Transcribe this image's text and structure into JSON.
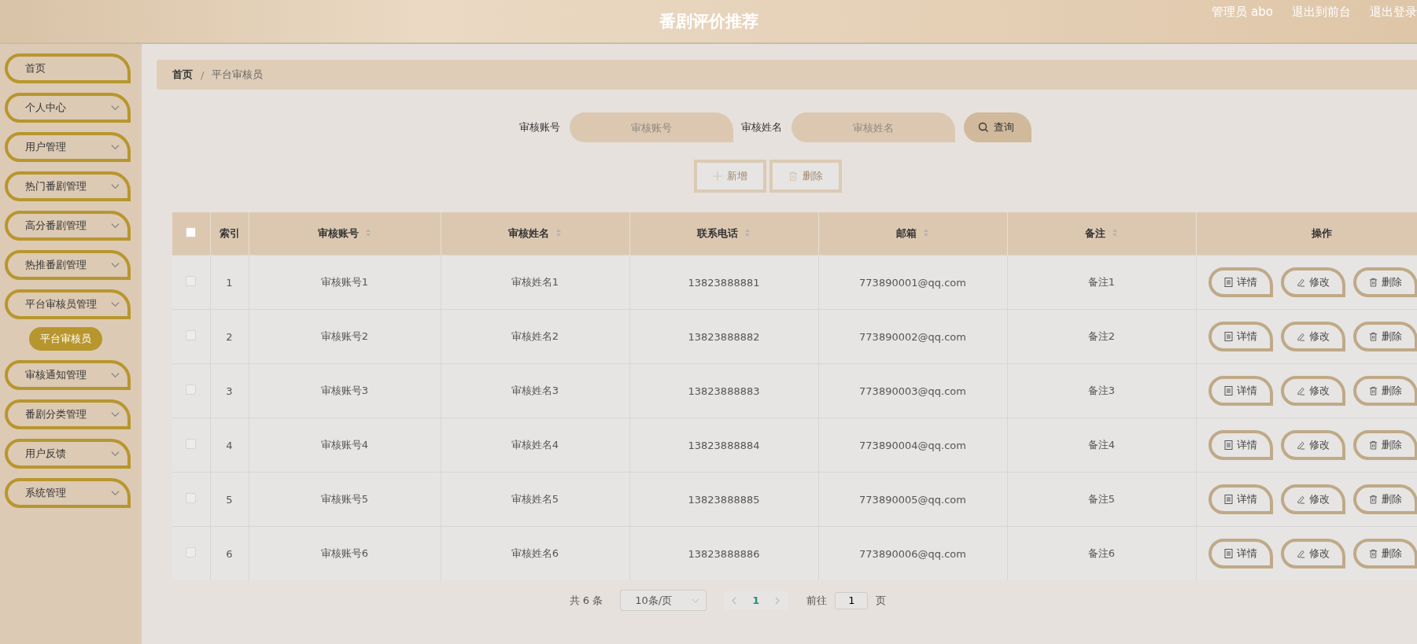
{
  "header": {
    "title": "番剧评价推荐",
    "links": [
      "管理员 abo",
      "退出到前台",
      "退出登录"
    ]
  },
  "sidebar": {
    "items": [
      {
        "label": "首页",
        "kind": "link"
      },
      {
        "label": "个人中心",
        "kind": "menu"
      },
      {
        "label": "用户管理",
        "kind": "menu"
      },
      {
        "label": "热门番剧管理",
        "kind": "menu"
      },
      {
        "label": "高分番剧管理",
        "kind": "menu"
      },
      {
        "label": "热推番剧管理",
        "kind": "menu"
      },
      {
        "label": "平台审核员管理",
        "kind": "menu",
        "children": [
          {
            "label": "平台审核员",
            "selected": true
          }
        ]
      },
      {
        "label": "审核通知管理",
        "kind": "menu"
      },
      {
        "label": "番剧分类管理",
        "kind": "menu"
      },
      {
        "label": "用户反馈",
        "kind": "menu"
      },
      {
        "label": "系统管理",
        "kind": "menu"
      }
    ]
  },
  "breadcrumb": {
    "items": [
      "首页",
      "平台审核员"
    ],
    "separator": "/"
  },
  "search": {
    "fields": [
      {
        "label": "审核账号",
        "placeholder": "审核账号"
      },
      {
        "label": "审核姓名",
        "placeholder": "审核姓名"
      }
    ],
    "button": "查询"
  },
  "actions": [
    {
      "label": "新增",
      "kind": "add"
    },
    {
      "label": "删除",
      "kind": "delete"
    }
  ],
  "table": {
    "all_checked": false,
    "columns": [
      {
        "label": "索引",
        "sortable": false
      },
      {
        "label": "审核账号",
        "sortable": true
      },
      {
        "label": "审核姓名",
        "sortable": true
      },
      {
        "label": "联系电话",
        "sortable": true
      },
      {
        "label": "邮箱",
        "sortable": true
      },
      {
        "label": "备注",
        "sortable": true
      },
      {
        "label": "操作",
        "sortable": false
      }
    ],
    "rows": [
      {
        "checked": false,
        "cells": [
          "1",
          "审核账号1",
          "审核姓名1",
          "13823888881",
          "773890001@qq.com",
          "备注1"
        ],
        "buttons": [
          {
            "label": "详情",
            "kind": "detail"
          },
          {
            "label": "修改",
            "kind": "edit"
          },
          {
            "label": "删除",
            "kind": "delete"
          }
        ]
      },
      {
        "checked": false,
        "cells": [
          "2",
          "审核账号2",
          "审核姓名2",
          "13823888882",
          "773890002@qq.com",
          "备注2"
        ],
        "buttons": [
          {
            "label": "详情",
            "kind": "detail"
          },
          {
            "label": "修改",
            "kind": "edit"
          },
          {
            "label": "删除",
            "kind": "delete"
          }
        ]
      },
      {
        "checked": false,
        "cells": [
          "3",
          "审核账号3",
          "审核姓名3",
          "13823888883",
          "773890003@qq.com",
          "备注3"
        ],
        "buttons": [
          {
            "label": "详情",
            "kind": "detail"
          },
          {
            "label": "修改",
            "kind": "edit"
          },
          {
            "label": "删除",
            "kind": "delete"
          }
        ]
      },
      {
        "checked": false,
        "cells": [
          "4",
          "审核账号4",
          "审核姓名4",
          "13823888884",
          "773890004@qq.com",
          "备注4"
        ],
        "buttons": [
          {
            "label": "详情",
            "kind": "detail"
          },
          {
            "label": "修改",
            "kind": "edit"
          },
          {
            "label": "删除",
            "kind": "delete"
          }
        ]
      },
      {
        "checked": false,
        "cells": [
          "5",
          "审核账号5",
          "审核姓名5",
          "13823888885",
          "773890005@qq.com",
          "备注5"
        ],
        "buttons": [
          {
            "label": "详情",
            "kind": "detail"
          },
          {
            "label": "修改",
            "kind": "edit"
          },
          {
            "label": "删除",
            "kind": "delete"
          }
        ]
      },
      {
        "checked": false,
        "cells": [
          "6",
          "审核账号6",
          "审核姓名6",
          "13823888886",
          "773890006@qq.com",
          "备注6"
        ],
        "buttons": [
          {
            "label": "详情",
            "kind": "detail"
          },
          {
            "label": "修改",
            "kind": "edit"
          },
          {
            "label": "删除",
            "kind": "delete"
          }
        ]
      }
    ]
  },
  "pagination": {
    "total": "共 6 条",
    "page_size": "10条/页",
    "pages": [
      {
        "label": "1",
        "selected": true
      }
    ],
    "goto_label": "前往",
    "goto_value": "1",
    "goto_suffix": "页"
  }
}
